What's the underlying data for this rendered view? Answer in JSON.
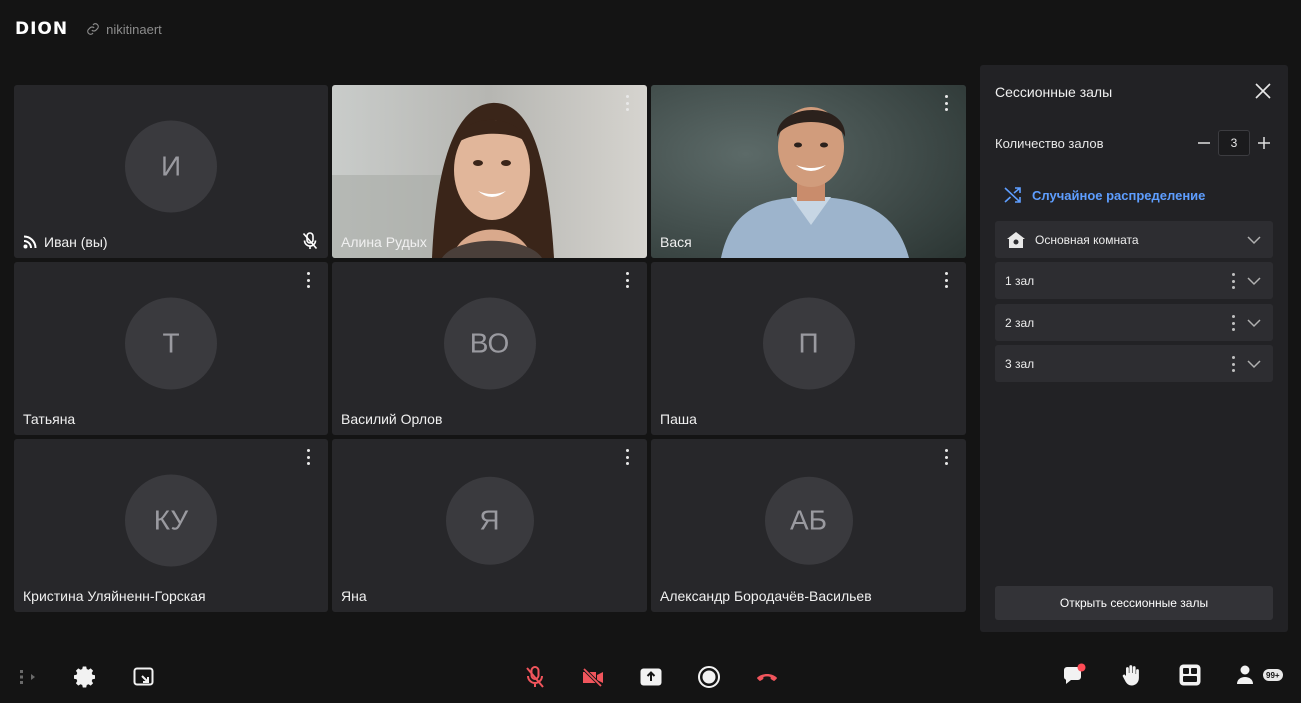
{
  "header": {
    "logo": "DION",
    "room_link": "nikitinaert"
  },
  "tiles": [
    {
      "name": "Иван (вы)",
      "initials": "И",
      "type": "avatar"
    },
    {
      "name": "Алина Рудых",
      "initials": "",
      "type": "video"
    },
    {
      "name": "Вася",
      "initials": "",
      "type": "video"
    },
    {
      "name": "Татьяна",
      "initials": "Т",
      "type": "avatar"
    },
    {
      "name": "Василий Орлов",
      "initials": "ВО",
      "type": "avatar"
    },
    {
      "name": "Паша",
      "initials": "П",
      "type": "avatar"
    },
    {
      "name": "Кристина Уляйненн-Горская",
      "initials": "КУ",
      "type": "avatar"
    },
    {
      "name": "Яна",
      "initials": "Я",
      "type": "avatar"
    },
    {
      "name": "Александр Бородачёв-Васильев",
      "initials": "АБ",
      "type": "avatar"
    }
  ],
  "panel": {
    "title": "Сессионные залы",
    "count_label": "Количество залов",
    "count_value": "3",
    "random_label": "Случайное распределение",
    "rooms": [
      {
        "label": "Основная комната"
      },
      {
        "label": "1 зал"
      },
      {
        "label": "2 зал"
      },
      {
        "label": "3 зал"
      }
    ],
    "open_button": "Открыть сессионные залы"
  },
  "toolbar": {
    "participants_badge": "99+",
    "colors": {
      "danger": "#f0555c",
      "accent": "#5e9eff",
      "notify": "#ff4b55"
    }
  }
}
